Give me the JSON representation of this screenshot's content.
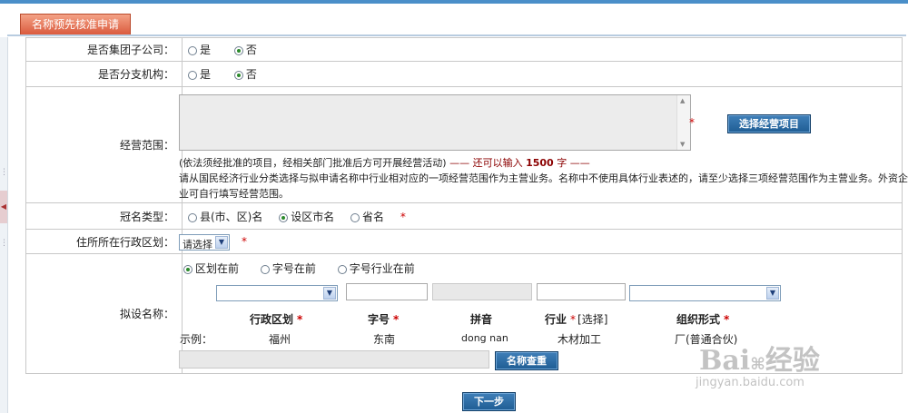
{
  "tab": {
    "label": "名称预先核准申请"
  },
  "rows": {
    "group": {
      "label": "是否集团子公司：",
      "options": [
        "是",
        "否"
      ],
      "selected": "否"
    },
    "branch": {
      "label": "是否分支机构：",
      "options": [
        "是",
        "否"
      ],
      "selected": "否"
    },
    "scope": {
      "label": "经营范围：",
      "textarea_value": "",
      "select_button": "选择经营项目",
      "note_main": "(依法须经批准的项目，经相关部门批准后方可开展经营活动)",
      "remain_prefix": "—— 还可以输入",
      "remain_count": "1500",
      "remain_suffix": "字 ——",
      "hint_line1": "请从国民经济行业分类选择与拟申请名称中行业相对应的一项经营范围作为主营业务。名称中不使用具体行业表述的，请至少选择三项经营范围作为主营业务。外资企",
      "hint_line2": "业可自行填写经营范围。"
    },
    "crown": {
      "label": "冠名类型：",
      "options": [
        "县(市、区)名",
        "设区市名",
        "省名"
      ],
      "selected": "设区市名"
    },
    "region": {
      "label": "住所所在行政区划：",
      "select_value": "请选择"
    },
    "proposed": {
      "label": "拟设名称：",
      "order_options": [
        "区划在前",
        "字号在前",
        "字号行业在前"
      ],
      "order_selected": "区划在前",
      "col_admin": "行政区划",
      "col_brand": "字号",
      "col_pinyin": "拼音",
      "col_industry": "行业",
      "col_industry_select": "[选择]",
      "col_org": "组织形式",
      "example_label": "示例：",
      "ex_admin": "福州",
      "ex_brand": "东南",
      "ex_pinyin": "dong nan",
      "ex_industry": "木材加工",
      "ex_org": "厂(普通合伙)",
      "check_button": "名称查重"
    }
  },
  "footer": {
    "next_button": "下一步"
  },
  "watermark": {
    "brand": "Bai",
    "brand2": "经验",
    "url": "jingyan.baidu.com"
  },
  "colors": {
    "accent": "#1f5d94",
    "required": "#cc0000",
    "tab": "#d9573a"
  }
}
